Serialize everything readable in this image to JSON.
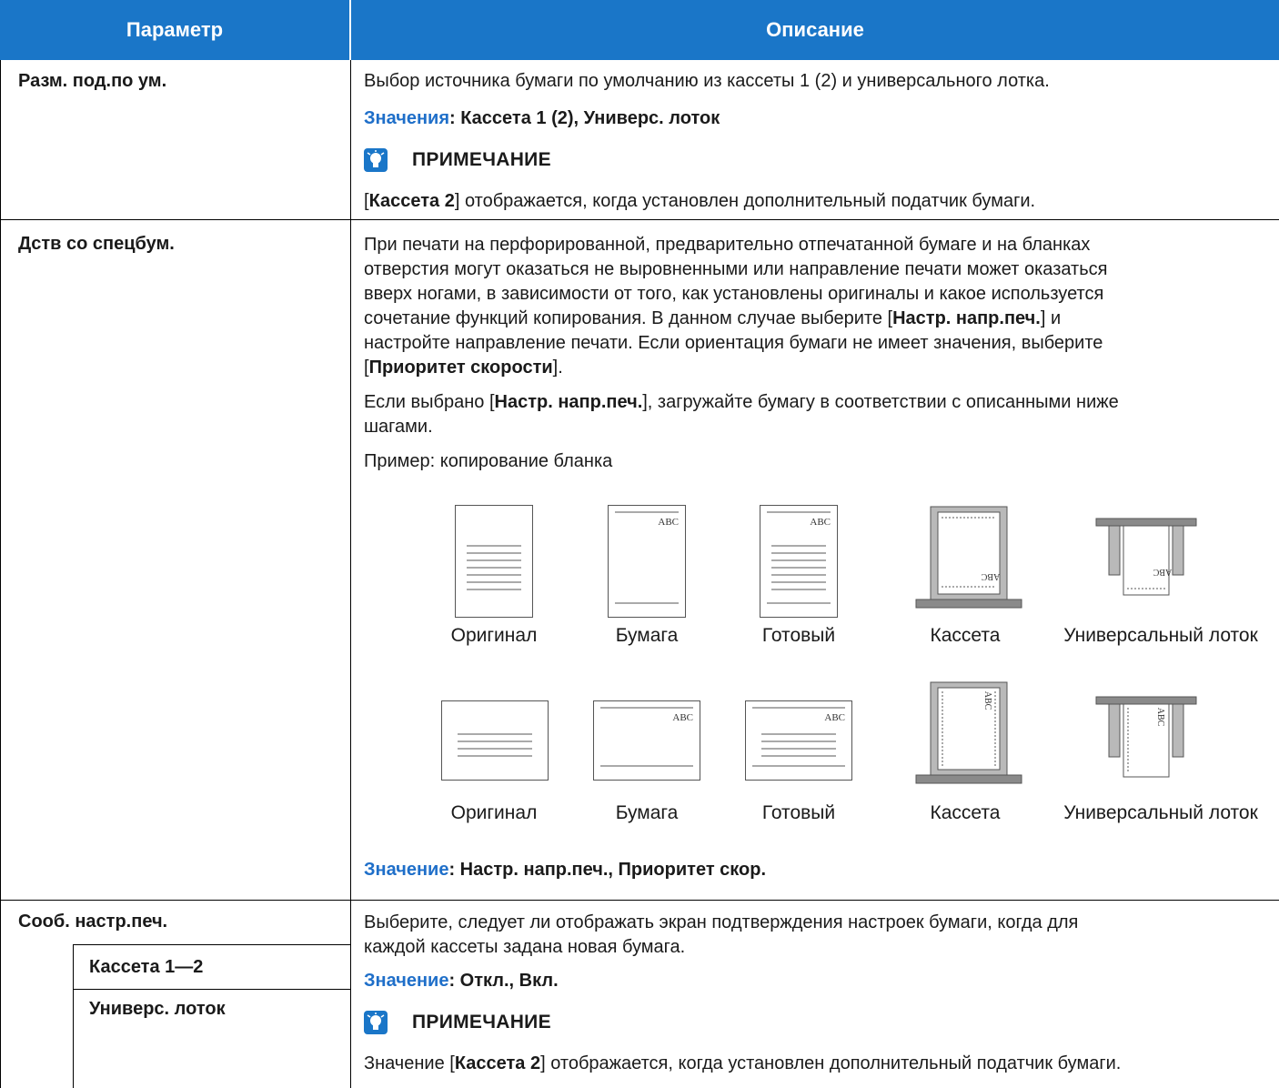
{
  "header": {
    "col1": "Параметр",
    "col2": "Описание"
  },
  "rows": [
    {
      "param": "Разм. под.по ум.",
      "desc": "Выбор источника бумаги по умолчанию из кассеты 1 (2) и универсального лотка.",
      "values_key": "Значения",
      "values": ": Кассета 1 (2), Универс. лоток",
      "note_title": "ПРИМЕЧАНИЕ",
      "note_pre": "[",
      "note_bold": "Кассета 2",
      "note_post": "] отображается, когда установлен дополнительный податчик бумаги."
    },
    {
      "param": "Дств со спецбум.",
      "p1_l1": "При печати на перфорированной, предварительно отпечатанной бумаге и на бланках",
      "p1_l2": "отверстия могут оказаться не выровненными или направление печати может оказаться",
      "p1_l3": "вверх ногами, в зависимости от того, как установлены оригиналы и какое используется",
      "p1_l4_pre": "сочетание функций копирования. В данном случае выберите [",
      "p1_l4_bold": "Настр. напр.печ.",
      "p1_l4_post": "] и",
      "p1_l5": "настройте направление печати. Если ориентация бумаги не имеет значения, выберите",
      "p1_l6_pre": "[",
      "p1_l6_bold": "Приоритет скорости",
      "p1_l6_post": "].",
      "p2_l1_pre": "Если выбрано [",
      "p2_l1_bold": "Настр. напр.печ.",
      "p2_l1_post": "], загружайте бумагу в соответствии с описанными ниже",
      "p2_l2": "шагами.",
      "example": "Пример: копирование бланка",
      "abc": "ABC",
      "captions": [
        "Оригинал",
        "Бумага",
        "Готовый",
        "Кассета",
        "Универсальный лоток"
      ],
      "value_key": "Значение",
      "value": ": Настр.  напр.печ., Приоритет скор."
    },
    {
      "param": "Сооб. настр.печ.",
      "sub1": "Кассета 1—2",
      "sub2": "Универс. лоток",
      "desc_l1": "Выберите, следует ли отображать экран подтверждения настроек бумаги, когда для",
      "desc_l2": "каждой кассеты задана новая бумага.",
      "value_key": "Значение",
      "value": ": Откл., Вкл.",
      "note_title": "ПРИМЕЧАНИЕ",
      "note_pre": "Значение [",
      "note_bold": "Кассета 2",
      "note_post": "] отображается, когда установлен дополнительный податчик бумаги."
    }
  ],
  "colors": {
    "header_bg": "#1a76c8",
    "value_key": "#1f6fc9",
    "note_icon": "#1a76c8"
  },
  "icons": {
    "note": "lightbulb-note-icon"
  }
}
